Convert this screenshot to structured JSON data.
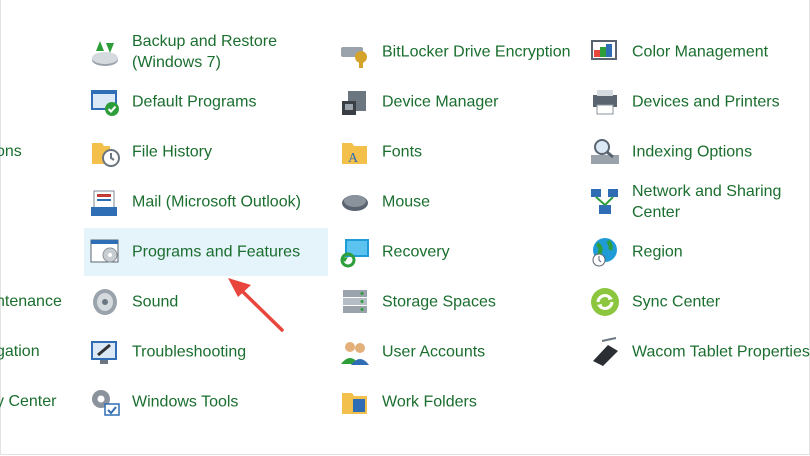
{
  "partial_left": [
    "ons",
    "ntenance",
    "gation",
    "y Center"
  ],
  "col1": [
    {
      "label": "Backup and Restore\n(Windows 7)",
      "icon": "backup-restore-icon"
    },
    {
      "label": "Default Programs",
      "icon": "default-programs-icon"
    },
    {
      "label": "File History",
      "icon": "file-history-icon"
    },
    {
      "label": "Mail (Microsoft Outlook)",
      "icon": "mail-icon"
    },
    {
      "label": "Programs and Features",
      "icon": "programs-features-icon"
    },
    {
      "label": "Sound",
      "icon": "sound-icon"
    },
    {
      "label": "Troubleshooting",
      "icon": "troubleshooting-icon"
    },
    {
      "label": "Windows Tools",
      "icon": "windows-tools-icon"
    }
  ],
  "col2": [
    {
      "label": "BitLocker Drive Encryption",
      "icon": "bitlocker-icon"
    },
    {
      "label": "Device Manager",
      "icon": "device-manager-icon"
    },
    {
      "label": "Fonts",
      "icon": "fonts-folder-icon"
    },
    {
      "label": "Mouse",
      "icon": "mouse-icon"
    },
    {
      "label": "Recovery",
      "icon": "recovery-icon"
    },
    {
      "label": "Storage Spaces",
      "icon": "storage-spaces-icon"
    },
    {
      "label": "User Accounts",
      "icon": "user-accounts-icon"
    },
    {
      "label": "Work Folders",
      "icon": "work-folders-icon"
    }
  ],
  "col3": [
    {
      "label": "Color Management",
      "icon": "color-management-icon"
    },
    {
      "label": "Devices and Printers",
      "icon": "devices-printers-icon"
    },
    {
      "label": "Indexing Options",
      "icon": "indexing-options-icon"
    },
    {
      "label": "Network and Sharing\nCenter",
      "icon": "network-sharing-icon"
    },
    {
      "label": "Region",
      "icon": "region-globe-icon"
    },
    {
      "label": "Sync Center",
      "icon": "sync-center-icon"
    },
    {
      "label": "Wacom Tablet Properties",
      "icon": "wacom-tablet-icon"
    }
  ],
  "selected": "Programs and Features",
  "colors": {
    "link": "#1a6e2e",
    "selection": "#e5f3fb",
    "arrow": "#e8453c"
  }
}
